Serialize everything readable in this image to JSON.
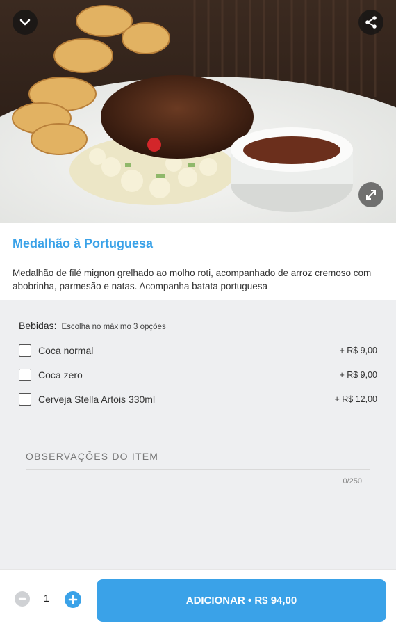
{
  "header": {
    "collapse_icon": "chevron-down-icon",
    "share_icon": "share-icon",
    "expand_icon": "expand-icon"
  },
  "item": {
    "title": "Medalhão à Portuguesa",
    "description": "Medalhão de filé mignon grelhado ao molho roti, acompanhado de arroz cremoso com abobrinha, parmesão e natas. Acompanha batata portuguesa"
  },
  "options_group": {
    "title": "Bebidas:",
    "hint": "Escolha no máximo 3 opções",
    "items": [
      {
        "label": "Coca normal",
        "price": "+ R$ 9,00",
        "checked": false
      },
      {
        "label": "Coca zero",
        "price": "+ R$ 9,00",
        "checked": false
      },
      {
        "label": "Cerveja Stella Artois 330ml",
        "price": "+ R$ 12,00",
        "checked": false
      }
    ]
  },
  "notes": {
    "label": "OBSERVAÇÕES DO ITEM",
    "counter": "0/250"
  },
  "footer": {
    "quantity": "1",
    "add_label": "ADICIONAR • R$ 94,00"
  },
  "colors": {
    "accent": "#3aa2e8",
    "section_bg": "#eeeff1"
  }
}
